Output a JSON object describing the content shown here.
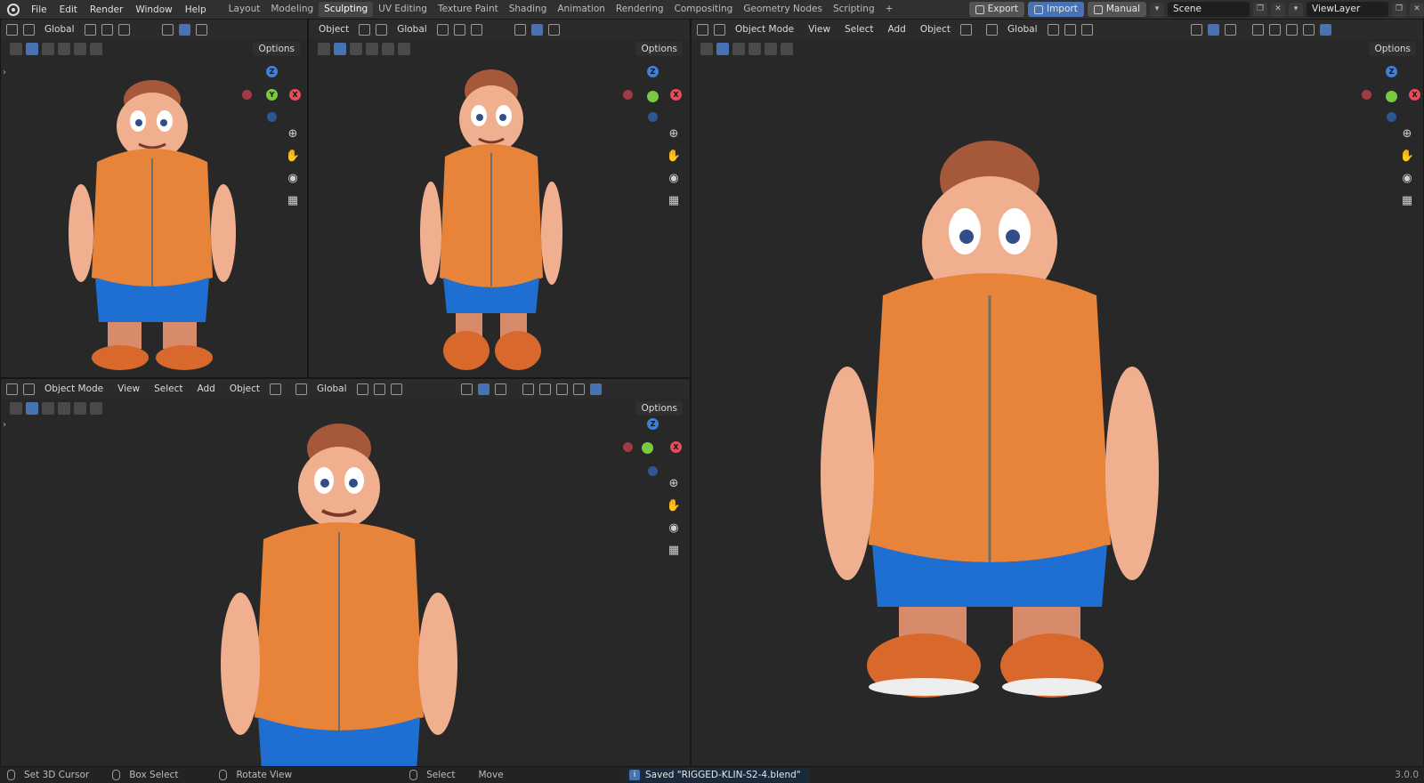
{
  "menu": [
    "File",
    "Edit",
    "Render",
    "Window",
    "Help"
  ],
  "workspace_tabs": [
    "Layout",
    "Modeling",
    "Sculpting",
    "UV Editing",
    "Texture Paint",
    "Shading",
    "Animation",
    "Rendering",
    "Compositing",
    "Geometry Nodes",
    "Scripting"
  ],
  "active_tab": "Sculpting",
  "add_tab_label": "+",
  "top_right": {
    "export_label": "Export",
    "import_label": "Import",
    "manual_label": "Manual",
    "scene_name": "Scene",
    "view_layer": "ViewLayer"
  },
  "viewports": {
    "top_left": {
      "transform": "Global",
      "options": "Options"
    },
    "top_middle": {
      "mode": "Object",
      "transform": "Global",
      "options": "Options"
    },
    "bottom_left": {
      "mode": "Object Mode",
      "view": "View",
      "select": "Select",
      "add": "Add",
      "object": "Object",
      "transform": "Global",
      "options": "Options"
    },
    "right": {
      "mode": "Object Mode",
      "view": "View",
      "select": "Select",
      "add": "Add",
      "object": "Object",
      "transform": "Global",
      "options": "Options"
    }
  },
  "gizmo_labels": {
    "x": "X",
    "y": "Y",
    "z": "Z"
  },
  "statusbar": {
    "set_cursor": "Set 3D Cursor",
    "box_select": "Box Select",
    "rotate_view": "Rotate View",
    "select": "Select",
    "move": "Move",
    "saved_message": "Saved \"RIGGED-KLIN-S2-4.blend\"",
    "version": "3.0.0"
  },
  "colors": {
    "vest": "#e8843a",
    "shorts": "#1e6fd1",
    "skin": "#f0b08f",
    "hair": "#a5583a",
    "accent": "#4772b3"
  }
}
